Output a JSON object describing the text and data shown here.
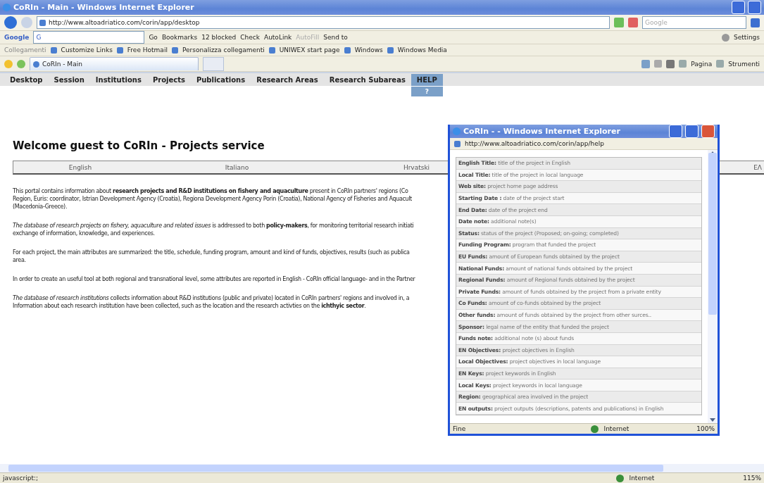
{
  "window": {
    "title": "CoRIn - Main - Windows Internet Explorer"
  },
  "address_bar": {
    "url": "http://www.altoadriatico.com/corin/app/desktop",
    "search_placeholder": "Google"
  },
  "google_toolbar": {
    "logo": "Google",
    "search_prefix": "G",
    "items": [
      {
        "label": "Go",
        "disabled": false
      },
      {
        "label": "Bookmarks",
        "disabled": false
      },
      {
        "label": "12 blocked",
        "disabled": false
      },
      {
        "label": "Check",
        "disabled": false
      },
      {
        "label": "AutoLink",
        "disabled": false
      },
      {
        "label": "AutoFill",
        "disabled": true
      },
      {
        "label": "Send to",
        "disabled": false
      }
    ],
    "settings": "Settings"
  },
  "links_bar": {
    "label": "Collegamenti",
    "links": [
      "Customize Links",
      "Free Hotmail",
      "Personalizza collegamenti",
      "UNIWEX start page",
      "Windows",
      "Windows Media"
    ]
  },
  "tab": {
    "label": "CoRIn - Main"
  },
  "command_bar": [
    "Pagina",
    "Strumenti"
  ],
  "menu": [
    {
      "label": "Desktop",
      "selected": false
    },
    {
      "label": "Session",
      "selected": false
    },
    {
      "label": "Institutions",
      "selected": false
    },
    {
      "label": "Projects",
      "selected": false
    },
    {
      "label": "Publications",
      "selected": false
    },
    {
      "label": "Research Areas",
      "selected": false
    },
    {
      "label": "Research Subareas",
      "selected": false
    },
    {
      "label": "HELP",
      "selected": true,
      "submenu": "?"
    }
  ],
  "page": {
    "heading": "Welcome guest to CoRIn - Projects service",
    "languages": [
      "English",
      "Italiano",
      "Hrvatski",
      "EΛ"
    ],
    "paragraphs": [
      [
        "This portal contains information about **research projects and R&D institutions on fishery and aquaculture** present in CoRIn partners' regions (Co",
        "Region, Euris: coordinator, Istrian Development Agency (Croatia), Regiona Development Agency Porin (Croatia), National Agency of Fisheries and Aquacult",
        "(Macedonia-Greece)."
      ],
      [
        "*The database of research projects on fishery, aquaculture and related issues* is addressed to both **policy-makers**, for monitoring territorial research initiati",
        "exchange of information, knowledge, and experiences."
      ],
      [
        "For each project, the main attributes are summarized: the title, schedule, funding program, amount and kind of funds, objectives, results (such as publica",
        "area."
      ],
      [
        "In order to create an useful tool at both regional and transnational level, some attributes are reported in English - CoRIn official language- and in the Partner"
      ],
      [
        "*The database of research institutions* collects information about R&D institutions (public and private) located in CoRIn partners' regions and involved in, a",
        "Information about each research institution have been collected, such as the location and the research activties on the **ichthyic sector**."
      ]
    ]
  },
  "status_bar": {
    "text": "javascript:;",
    "zone": "Internet",
    "zoom": "115%"
  },
  "popup": {
    "title": "CoRIn - - Windows Internet Explorer",
    "url": "http://www.altoadriatico.com/corin/app/help",
    "rows": [
      {
        "term": "English Title:",
        "desc": "title of the project in English"
      },
      {
        "term": "Local Title:",
        "desc": "title of the project in local language"
      },
      {
        "term": "Web site:",
        "desc": "project home page address"
      },
      {
        "term": "Starting Date :",
        "desc": "date of the project start"
      },
      {
        "term": "End Date:",
        "desc": "date of the project end"
      },
      {
        "term": "Date note:",
        "desc": "additional note(s)"
      },
      {
        "term": "Status:",
        "desc": "status of the project (Proposed; on-going; completed)"
      },
      {
        "term": "Funding Program:",
        "desc": "program that funded the project"
      },
      {
        "term": "EU Funds:",
        "desc": "amount of European funds obtained by the project"
      },
      {
        "term": "National Funds:",
        "desc": "amount of national funds obtained by the project"
      },
      {
        "term": "Regional Funds:",
        "desc": "amount of Regional funds obtained by the project"
      },
      {
        "term": "Private Funds:",
        "desc": "amount of funds obtained by the project from a private entity"
      },
      {
        "term": "Co Funds:",
        "desc": "amount of co-funds obtained by the project"
      },
      {
        "term": "Other funds:",
        "desc": "amount of funds obtained by the project from other surces.."
      },
      {
        "term": "Sponsor:",
        "desc": "legal name of the entity that funded the project"
      },
      {
        "term": "Funds note:",
        "desc": "additional note (s) about funds"
      },
      {
        "term": "EN Objectives:",
        "desc": "project objectives in English"
      },
      {
        "term": "Local Objectives:",
        "desc": "project objectives in local language"
      },
      {
        "term": "EN Keys:",
        "desc": "project keywords in English"
      },
      {
        "term": "Local Keys:",
        "desc": "project keywords in local language"
      },
      {
        "term": "Region:",
        "desc": "geographical area involved in the project"
      },
      {
        "term": "EN outputs:",
        "desc": "project outputs (descriptions, patents and publications) in English"
      }
    ],
    "status_bar": {
      "text": "Fine",
      "zone": "Internet",
      "zoom": "100%"
    }
  }
}
